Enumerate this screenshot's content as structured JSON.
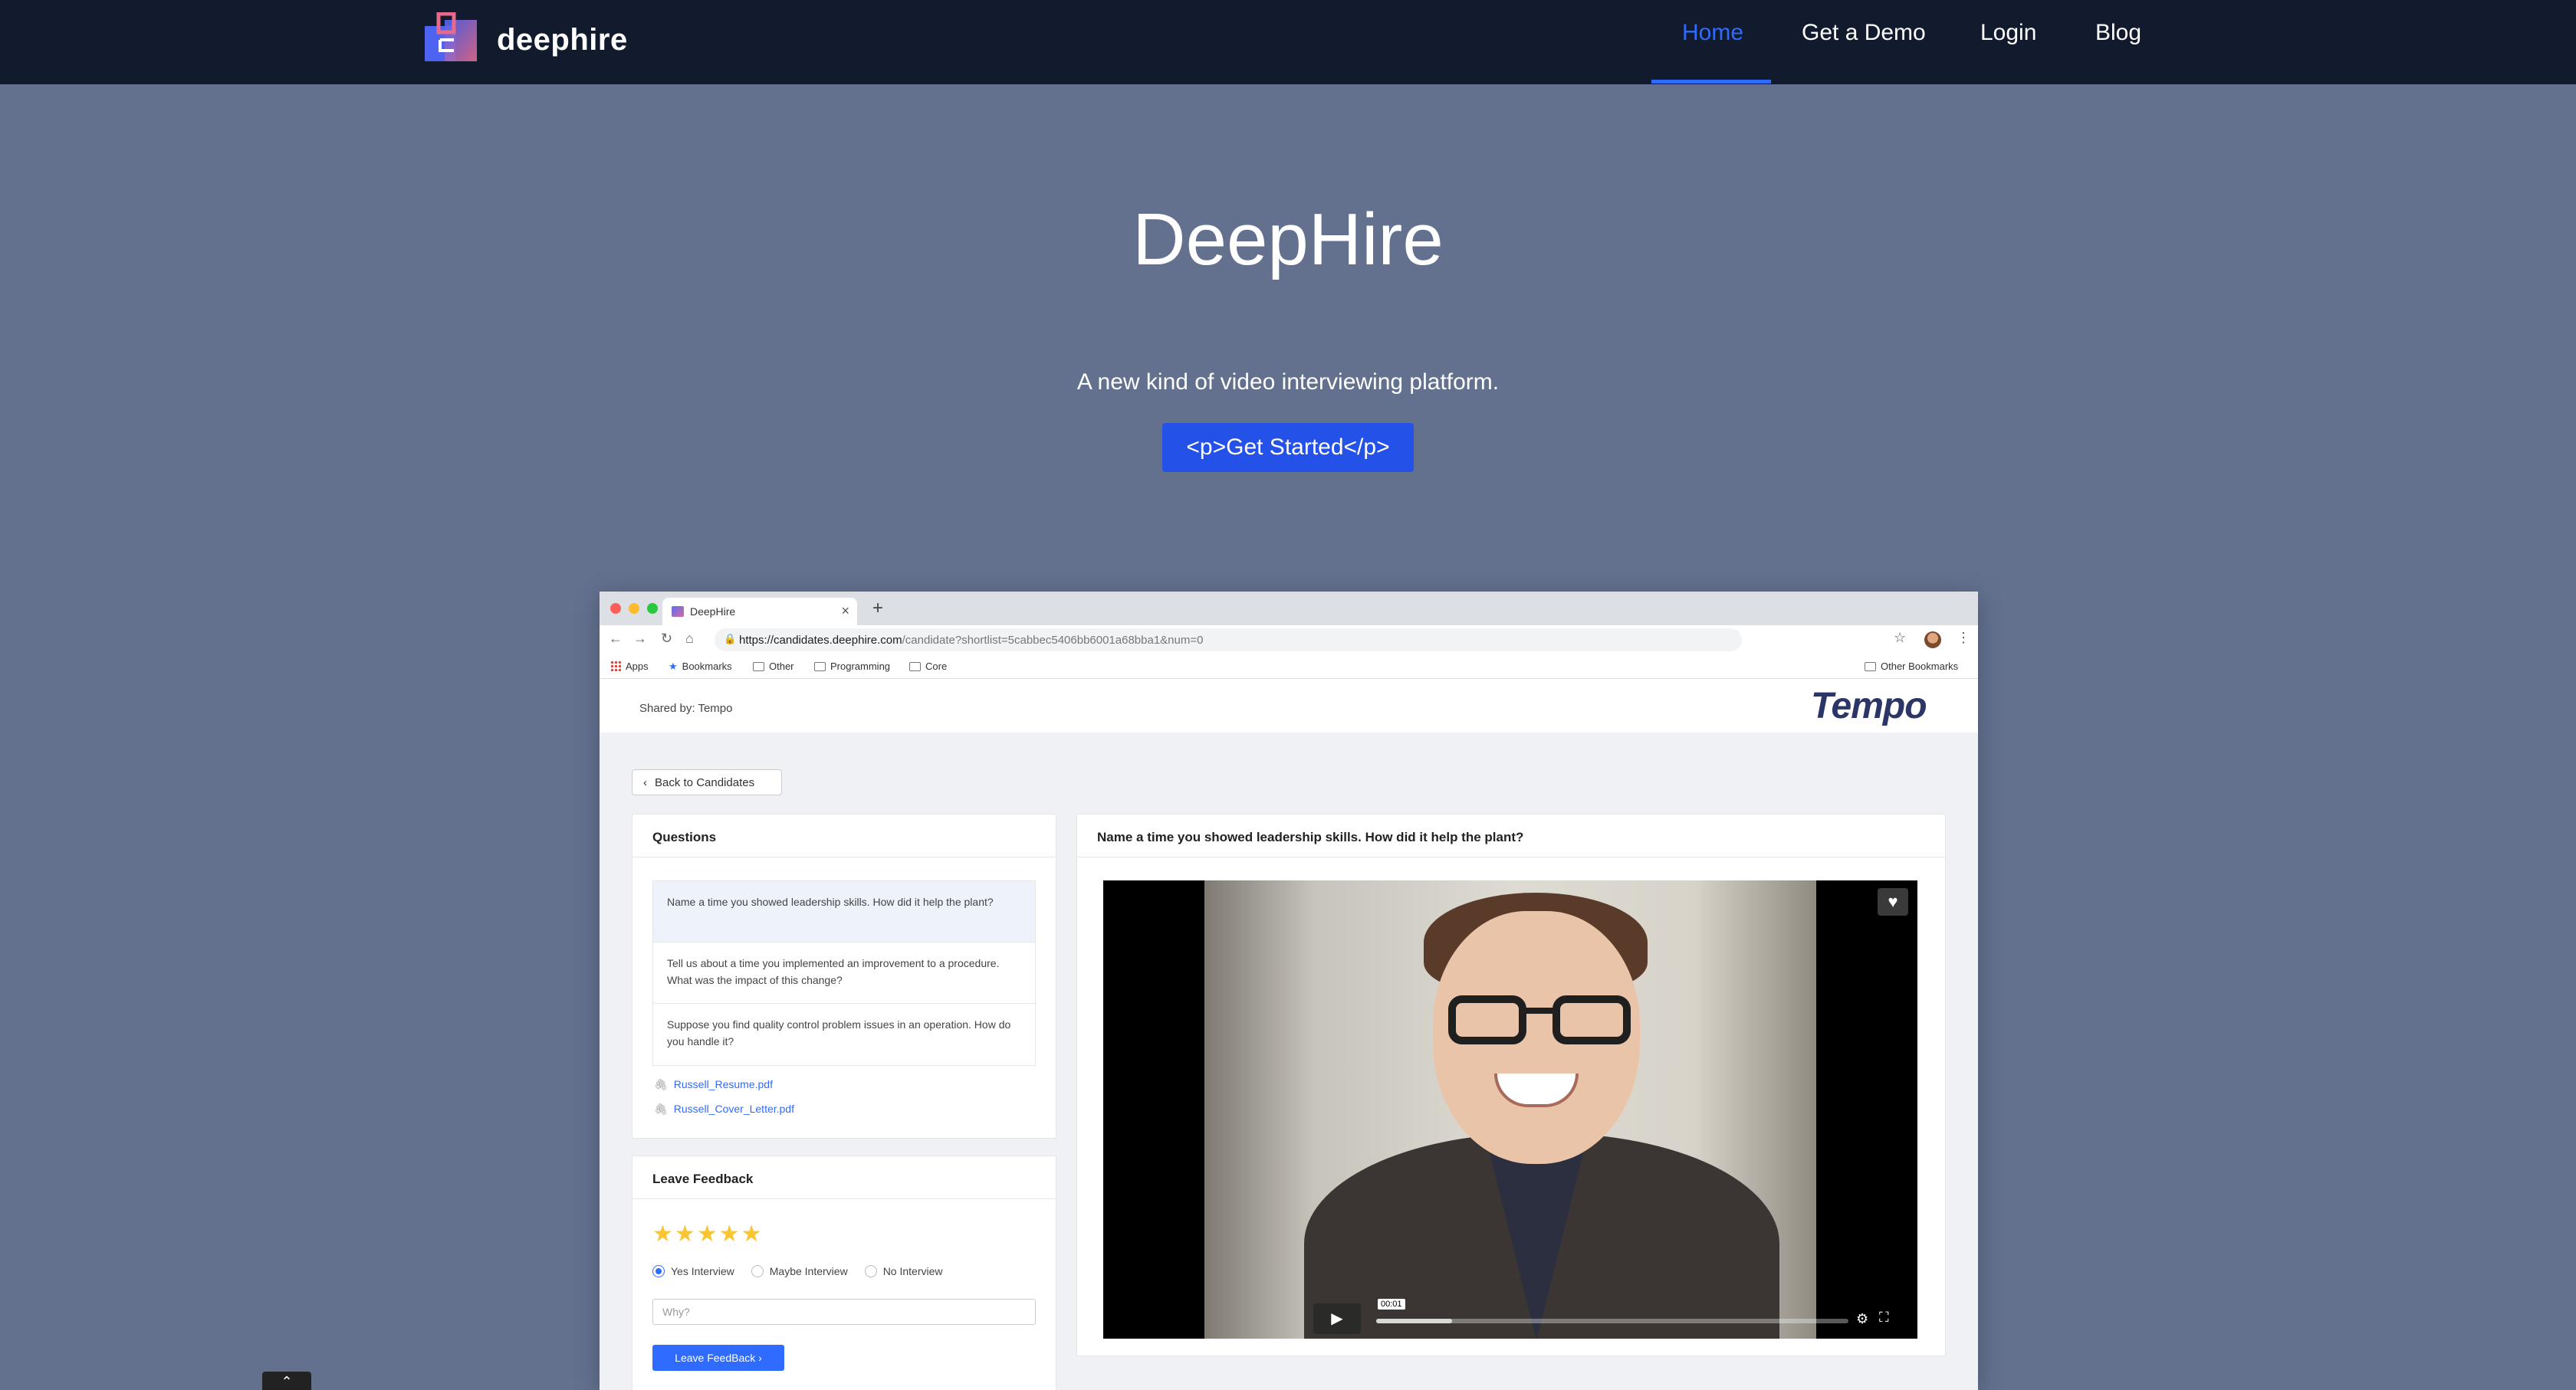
{
  "nav": {
    "brand": "deephire",
    "items": [
      "Home",
      "Get a Demo",
      "Login",
      "Blog"
    ],
    "active": "Home"
  },
  "hero": {
    "title": "DeepHire",
    "subtitle": "A new kind of video interviewing platform.",
    "cta_label": "<p>Get Started</p>"
  },
  "browser": {
    "tab_title": "DeepHire",
    "url_host": "https://candidates.deephire.com",
    "url_path": "/candidate?shortlist=5cabbec5406bb6001a68bba1&num=0",
    "bookmarks": [
      "Apps",
      "Bookmarks",
      "Other",
      "Programming",
      "Core"
    ],
    "other_bookmarks": "Other Bookmarks"
  },
  "page": {
    "shared_by": "Shared by: Tempo",
    "company_logo": "Tempo",
    "back_label": "Back to Candidates",
    "questions_title": "Questions",
    "questions": [
      "Name a time you showed leadership skills. How did it help the plant?",
      "Tell us about a time you implemented an improvement to a procedure. What was the impact of this change?",
      "Suppose you find quality control problem issues in an operation. How do you handle it?"
    ],
    "attachments": [
      "Russell_Resume.pdf",
      "Russell_Cover_Letter.pdf"
    ],
    "feedback_title": "Leave Feedback",
    "rating": 5,
    "radio_options": [
      "Yes Interview",
      "Maybe Interview",
      "No Interview"
    ],
    "selected_option": "Yes Interview",
    "why_placeholder": "Why?",
    "feedback_button": "Leave FeedBack",
    "current_question": "Name a time you showed leadership skills. How did it help the plant?",
    "video_time": "00:01",
    "video_progress": 0.16
  },
  "colors": {
    "nav_bg": "#121b2e",
    "page_bg": "#63718f",
    "accent": "#2f6bff",
    "cta": "#2451e8",
    "star": "#fbc531"
  }
}
